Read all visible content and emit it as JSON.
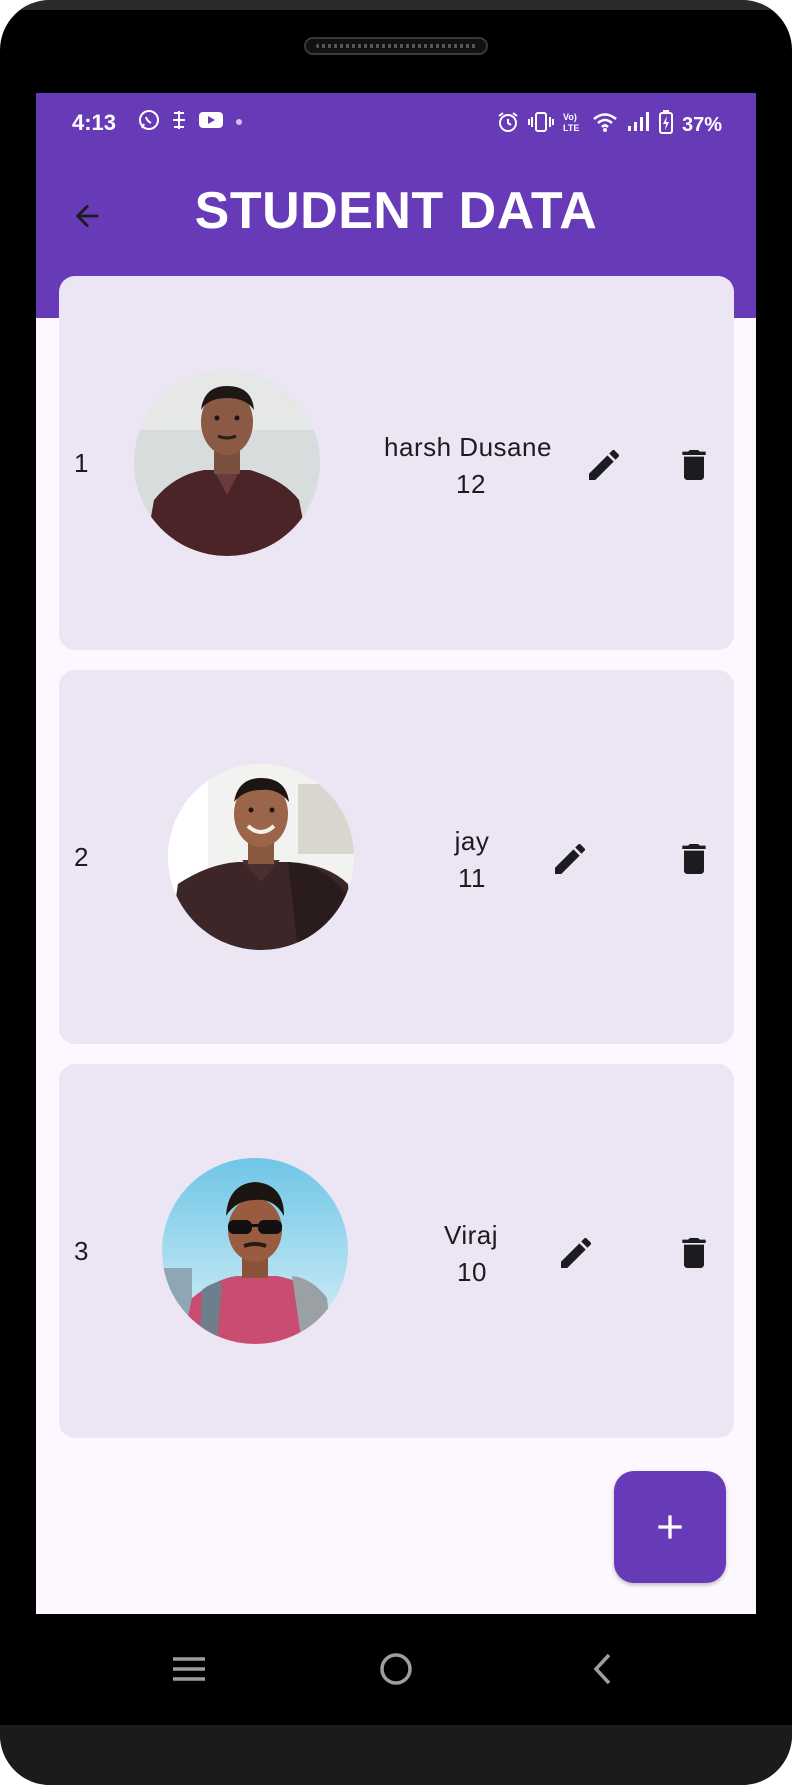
{
  "status_bar": {
    "time": "4:13",
    "battery": "37%",
    "left_icons": [
      "whatsapp-icon",
      "app-icon",
      "youtube-icon",
      "dot-icon"
    ],
    "right_icons": [
      "alarm-icon",
      "vibrate-icon",
      "volte-icon",
      "wifi-icon",
      "signal-icon",
      "battery-icon"
    ]
  },
  "app_bar": {
    "title": "STUDENT DATA",
    "back_icon": "arrow-left-icon"
  },
  "students": [
    {
      "index": "1",
      "name": "harsh Dusane",
      "number": "12"
    },
    {
      "index": "2",
      "name": "jay",
      "number": "11"
    },
    {
      "index": "3",
      "name": "Viraj",
      "number": "10"
    }
  ],
  "fab": {
    "label": "+",
    "icon": "plus-icon"
  },
  "nav_bar": {
    "icons": [
      "recents-icon",
      "home-icon",
      "back-icon"
    ]
  },
  "colors": {
    "primary": "#673ab7",
    "card_bg": "#ece6f4",
    "screen_bg": "#fdf7ff",
    "text": "#1c1b1f"
  }
}
